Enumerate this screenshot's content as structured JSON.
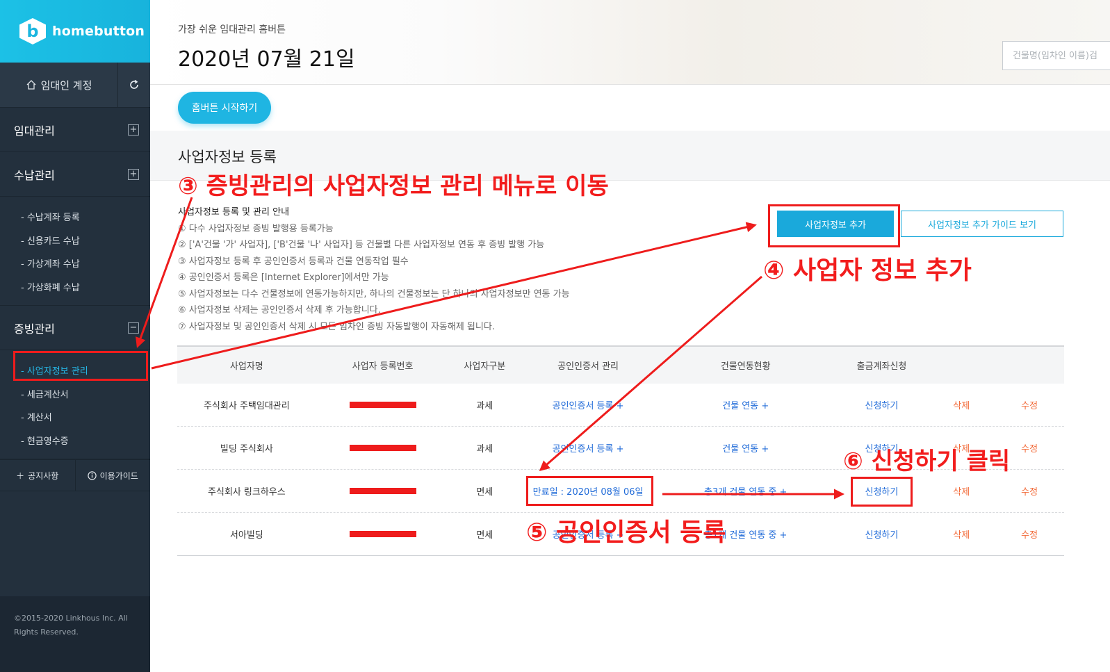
{
  "sidebar": {
    "logo_text": "homebutton",
    "logo_glyph": "b",
    "account_label": "임대인 계정",
    "menus": [
      {
        "label": "임대관리",
        "toggle": "+"
      },
      {
        "label": "수납관리",
        "toggle": "+"
      },
      {
        "label": "증빙관리",
        "toggle": "−"
      }
    ],
    "payment_items": [
      "- 수납계좌 등록",
      "- 신용카드 수납",
      "- 가상계좌 수납",
      "- 가상화폐 수납"
    ],
    "evidence_items": [
      "- 사업자정보 관리",
      "- 세금계산서",
      "- 계산서",
      "- 현금영수증"
    ],
    "notice_label": "공지사항",
    "guide_label": "이용가이드",
    "copyright_line1": "©2015-2020 Linkhous Inc. All",
    "copyright_line2": "Rights Reserved."
  },
  "header": {
    "tagline": "가장 쉬운 임대관리 홈버튼",
    "date": "2020년 07월 21일",
    "search_placeholder": "건물명(임차인 이름)검"
  },
  "start_button": "홈버튼 시작하기",
  "section": {
    "title": "사업자정보 등록",
    "guide_title": "사업자정보 등록 및 관리 안내",
    "guide_lines": [
      "① 다수 사업자정보 증빙 발행용 등록가능",
      "② ['A'건물 '가' 사업자], ['B'건물 '나' 사업자] 등 건물별 다른 사업자정보 연동 후 증빙 발행 가능",
      "③ 사업자정보 등록 후 공인인증서 등록과 건물 연동작업 필수",
      "④ 공인인증서 등록은 [Internet Explorer]에서만 가능",
      "⑤ 사업자정보는 다수 건물정보에 연동가능하지만, 하나의 건물정보는 단 하나의 사업자정보만 연동 가능",
      "⑥ 사업자정보 삭제는 공인인증서 삭제 후 가능합니다.",
      "⑦ 사업자정보 및 공인인증서 삭제 시 모든 임차인 증빙 자동발행이 자동해제 됩니다."
    ],
    "add_button": "사업자정보 추가",
    "guide_button": "사업자정보 추가 가이드 보기"
  },
  "table": {
    "headers": [
      "사업자명",
      "사업자 등록번호",
      "사업자구분",
      "공인인증서 관리",
      "건물연동현황",
      "출금계좌신청",
      "",
      ""
    ],
    "rows": [
      {
        "name": "주식회사 주택임대관리",
        "type": "과세",
        "cert": "공인인증서 등록 +",
        "building": "건물 연동 +",
        "apply": "신청하기",
        "delete": "삭제",
        "edit": "수정"
      },
      {
        "name": "빌딩 주식회사",
        "type": "과세",
        "cert": "공인인증서 등록 +",
        "building": "건물 연동 +",
        "apply": "신청하기",
        "delete": "삭제",
        "edit": "수정"
      },
      {
        "name": "주식회사 링크하우스",
        "type": "면세",
        "cert": "만료일 : 2020년 08월 06일",
        "building": "총3개 건물 연동 중 +",
        "apply": "신청하기",
        "delete": "삭제",
        "edit": "수정"
      },
      {
        "name": "서아빌딩",
        "type": "면세",
        "cert": "공인인증서 등록 +",
        "building": "총1개 건물 연동 중 +",
        "apply": "신청하기",
        "delete": "삭제",
        "edit": "수정"
      }
    ]
  },
  "annotations": {
    "step3": "③ 증빙관리의 사업자정보 관리 메뉴로 이동",
    "step4": "④ 사업자 정보 추가",
    "step5": "⑤ 공인인증서 등록",
    "step6": "⑥ 신청하기 클릭"
  },
  "colors": {
    "accent": "#1fb5e2",
    "sidebar": "#23303d",
    "annotation": "#f21d1d",
    "link": "#1f6ad8",
    "delete": "#f26b3a"
  }
}
